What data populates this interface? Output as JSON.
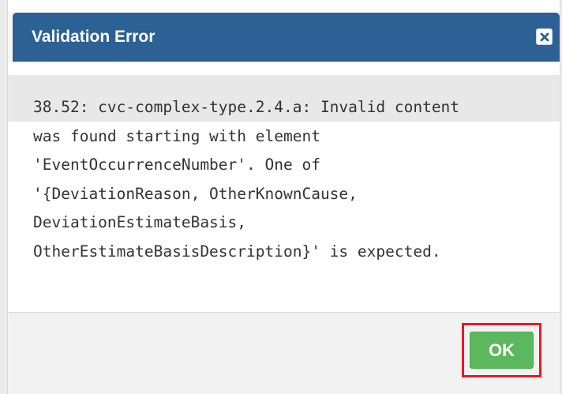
{
  "dialog": {
    "title": "Validation Error",
    "close_icon": "close-x-icon",
    "message_lines": [
      "38.52: cvc-complex-type.2.4.a: Invalid content",
      "was found starting with element",
      "'EventOccurrenceNumber'. One of",
      "'{DeviationReason, OtherKnownCause,",
      "DeviationEstimateBasis,",
      "OtherEstimateBasisDescription}' is expected."
    ],
    "ok_label": "OK"
  },
  "colors": {
    "header_background": "#2b6194",
    "ok_button": "#5cb85c",
    "highlight_outline": "#e41b24"
  }
}
